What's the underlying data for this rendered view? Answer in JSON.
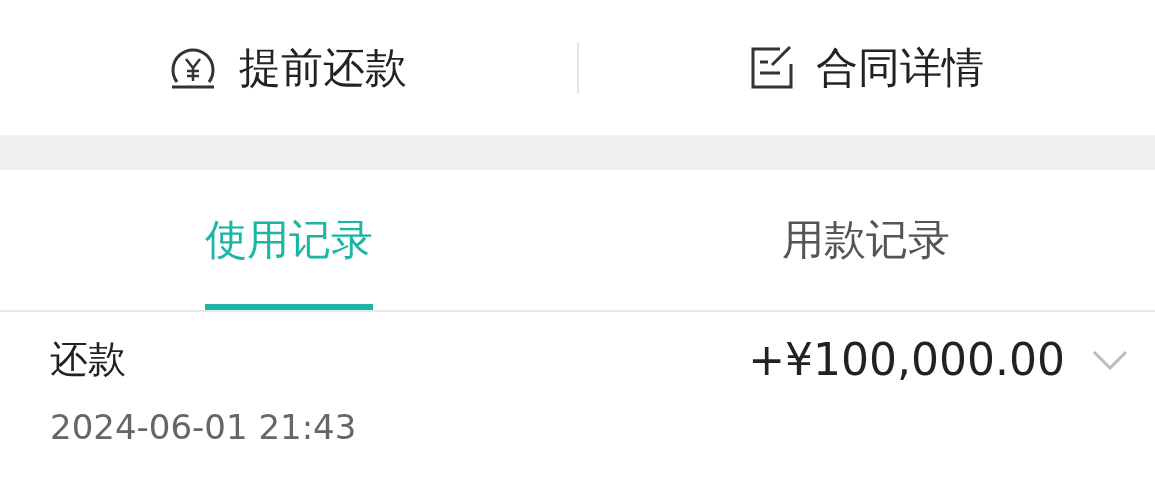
{
  "actions": [
    {
      "kind": "prepay",
      "label": "提前还款"
    },
    {
      "kind": "contract",
      "label": "合同详情"
    }
  ],
  "tabs": [
    {
      "label": "使用记录",
      "selected": true
    },
    {
      "label": "用款记录",
      "selected": false
    }
  ],
  "records": [
    {
      "title": "还款",
      "amount": "+¥100,000.00",
      "time": "2024-06-01 21:43",
      "expanded": false
    }
  ]
}
